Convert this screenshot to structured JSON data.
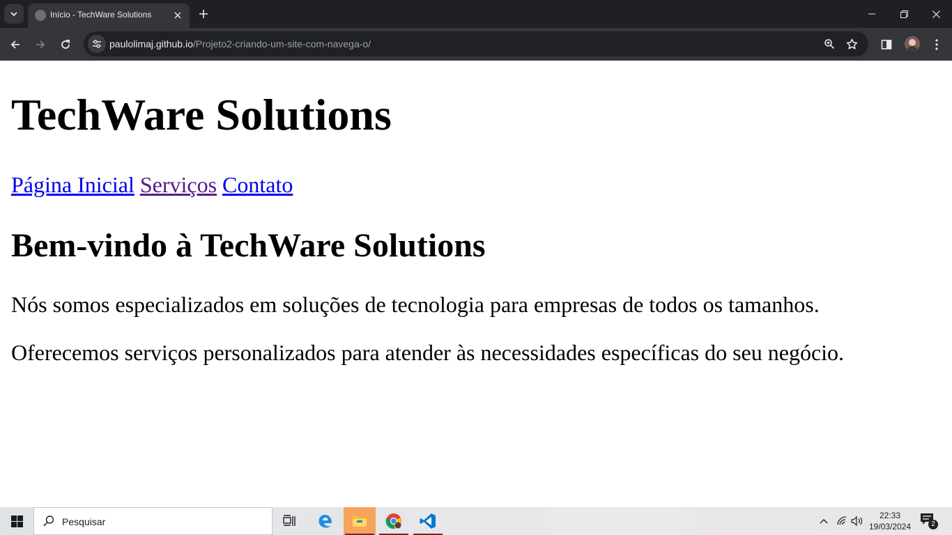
{
  "browser": {
    "tab_title": "Início - TechWare Solutions",
    "url_host": "paulolimaj.github.io",
    "url_path": "/Projeto2-criando-um-site-com-navega-o/"
  },
  "page": {
    "heading": "TechWare Solutions",
    "nav_links": [
      "Página Inicial",
      "Serviços",
      "Contato"
    ],
    "subheading": "Bem-vindo à TechWare Solutions",
    "paragraphs": [
      "Nós somos especializados em soluções de tecnologia para empresas de todos os tamanhos.",
      "Oferecemos serviços personalizados para atender às necessidades específicas do seu negócio."
    ]
  },
  "taskbar": {
    "search_placeholder": "Pesquisar",
    "clock_time": "22:33",
    "clock_date": "19/03/2024",
    "notification_count": "2"
  },
  "colors": {
    "link": "#0000ee",
    "visited_link": "#551a8b",
    "chrome_dark": "#35363a"
  }
}
